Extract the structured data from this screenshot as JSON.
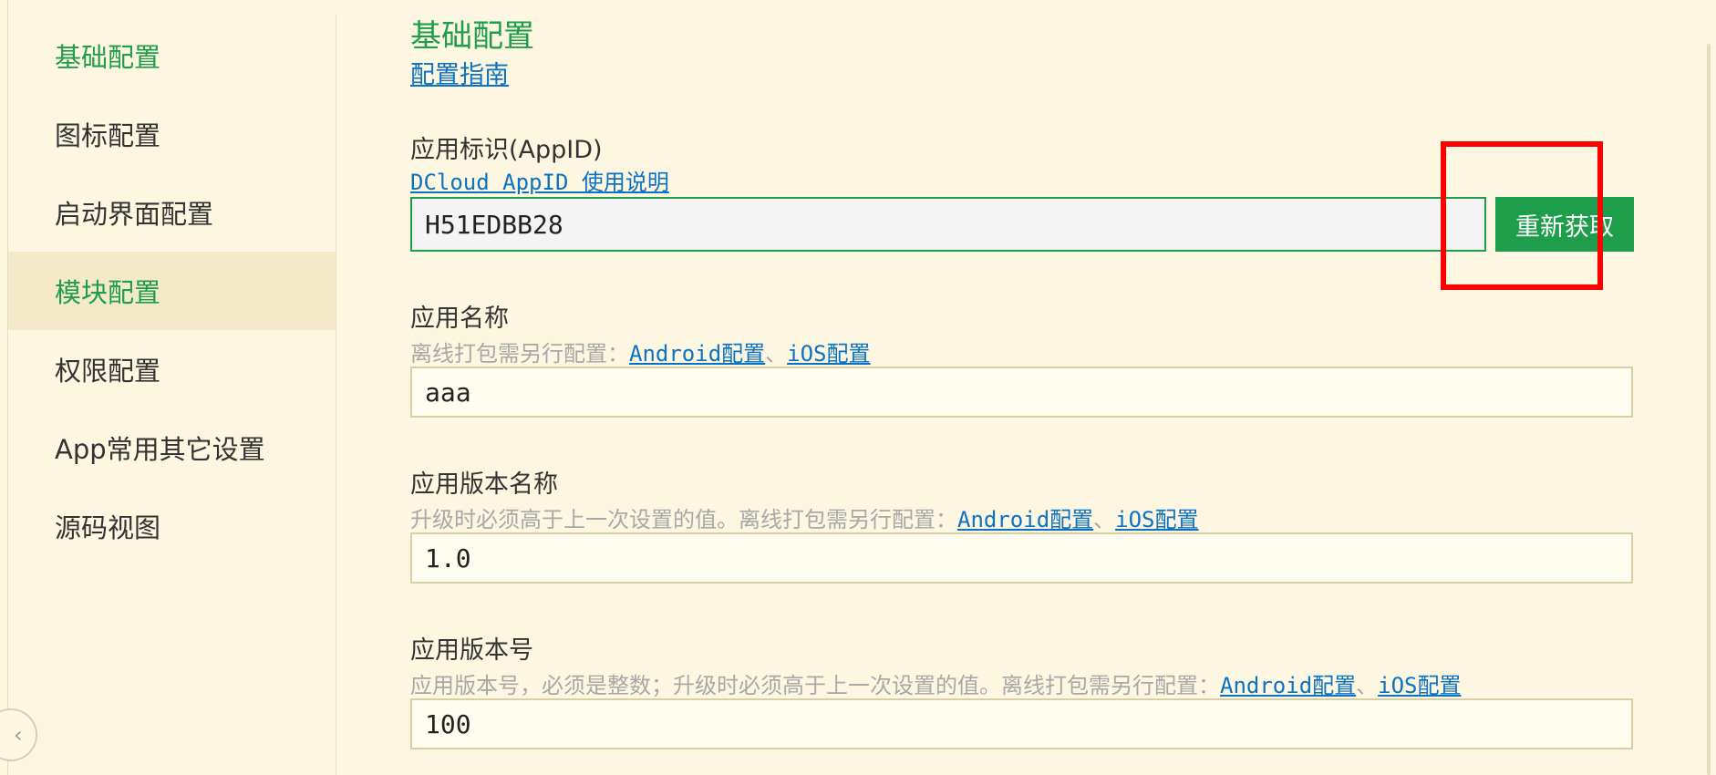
{
  "sidebar": {
    "items": [
      {
        "label": "基础配置"
      },
      {
        "label": "图标配置"
      },
      {
        "label": "启动界面配置"
      },
      {
        "label": "模块配置"
      },
      {
        "label": "权限配置"
      },
      {
        "label": "App常用其它设置"
      },
      {
        "label": "源码视图"
      }
    ],
    "collapse_icon": "chevron-left-icon"
  },
  "main": {
    "title": "基础配置",
    "guide_link": "配置指南",
    "appid": {
      "label": "应用标识(AppID)",
      "help_link": "DCloud AppID 使用说明",
      "value": "H51EDBB28",
      "button": "重新获取"
    },
    "app_name": {
      "label": "应用名称",
      "help": "离线打包需另行配置：",
      "android_link": "Android配置",
      "separator": "、",
      "ios_link": "iOS配置",
      "value": "aaa"
    },
    "version_name": {
      "label": "应用版本名称",
      "help": "升级时必须高于上一次设置的值。离线打包需另行配置：",
      "android_link": "Android配置",
      "separator": "、",
      "ios_link": "iOS配置",
      "value": "1.0"
    },
    "version_code": {
      "label": "应用版本号",
      "help": "应用版本号，必须是整数；升级时必须高于上一次设置的值。离线打包需另行配置：",
      "android_link": "Android配置",
      "separator": "、",
      "ios_link": "iOS配置",
      "value": "100"
    }
  },
  "colors": {
    "accent": "#1e9e4a",
    "link": "#0b72c4",
    "background": "#fdf7e1",
    "highlight": "#ff0000"
  }
}
